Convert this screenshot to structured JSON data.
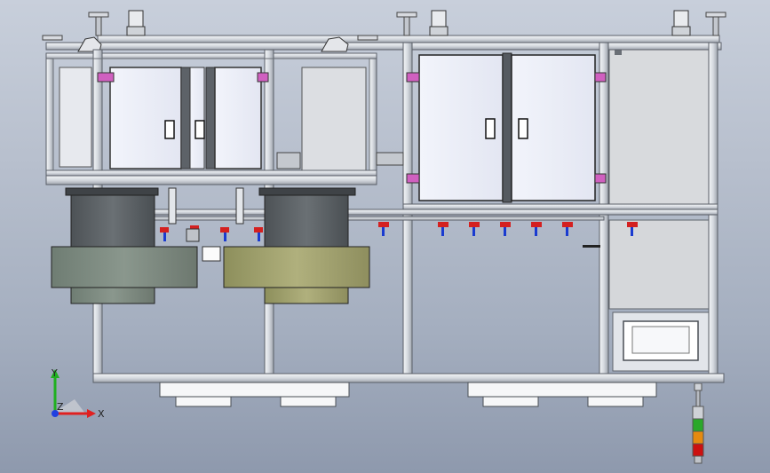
{
  "viewport": {
    "background": "gradient-grey-blue",
    "model": "machine-frame-front-view"
  },
  "triad": {
    "x_label": "X",
    "y_label": "Y",
    "z_label": "Z",
    "x_color": "#e02020",
    "y_color": "#20b020",
    "z_color": "#2040e0"
  },
  "colors": {
    "frame": "#d9dde4",
    "frame_edge": "#5a5f68",
    "door_glass": "#eef0f8",
    "tank_dark": "#5b6064",
    "tank_green_gray": "#7e8c82",
    "tank_olive": "#a6a774",
    "hinge_pink": "#d060c0",
    "nozzle_red": "#d42020",
    "nozzle_blue": "#1a3bd0"
  },
  "status_light": {
    "segments": [
      "grey",
      "green",
      "orange",
      "red"
    ]
  }
}
